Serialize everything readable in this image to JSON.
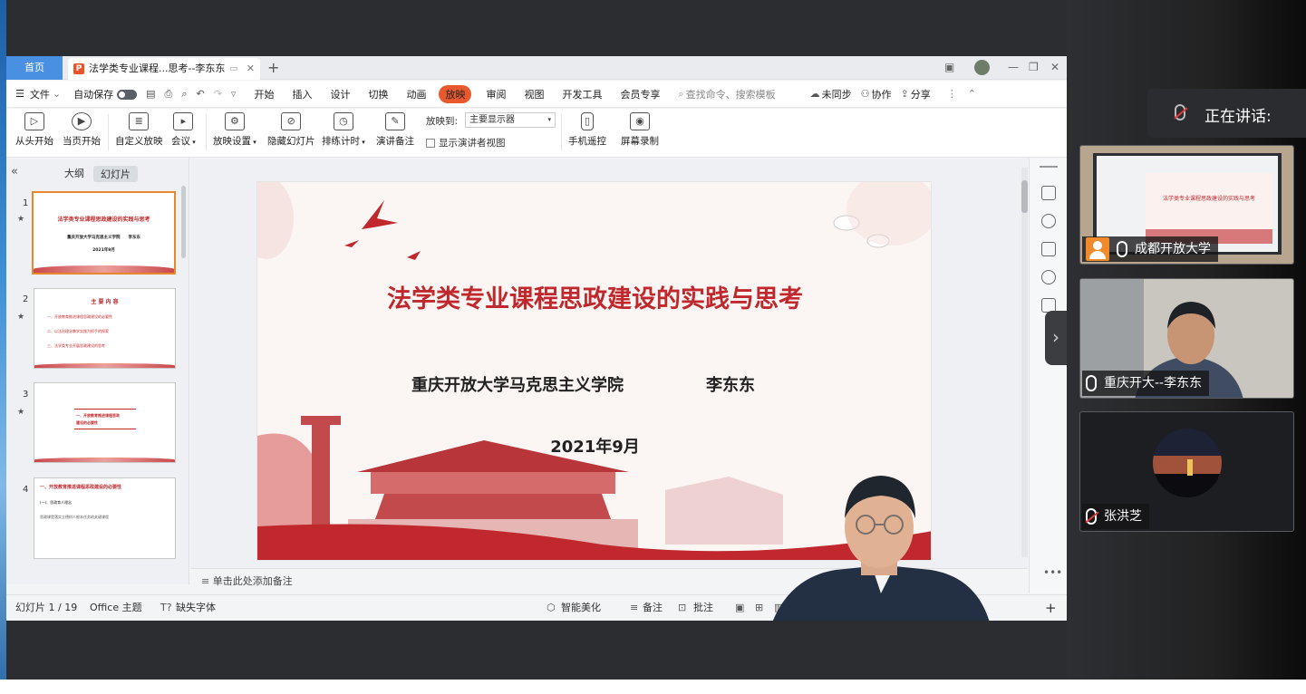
{
  "wps": {
    "home_tab": "首页",
    "doc_tab": "法学类专业课程...思考--李东东",
    "menu": {
      "file": "文件",
      "autosave": "自动保存",
      "items": [
        "开始",
        "插入",
        "设计",
        "切换",
        "动画",
        "放映",
        "审阅",
        "视图",
        "开发工具",
        "会员专享"
      ],
      "active_item": "放映",
      "search": "查找命令、搜索模板",
      "unsync": "未同步",
      "collab": "协作",
      "share": "分享"
    },
    "ribbon": {
      "from_start": "从头开始",
      "from_current": "当页开始",
      "custom_show": "自定义放映",
      "meeting": "会议",
      "show_settings": "放映设置",
      "hide_slide": "隐藏幻灯片",
      "rehearse": "排练计时",
      "speaker_notes": "演讲备注",
      "show_to_label": "放映到:",
      "show_to_value": "主要显示器",
      "presenter_view": "显示演讲者视图",
      "phone_remote": "手机遥控",
      "screen_record": "屏幕录制"
    },
    "left_panel": {
      "tab_outline": "大纲",
      "tab_slides": "幻灯片",
      "thumbs": [
        {
          "num": "1",
          "title": "法学类专业课程思政建设的实践与思考",
          "lines": [
            "重庆开放大学马克思主义学院　　李东东",
            "2021年9月"
          ]
        },
        {
          "num": "2",
          "title": "主 要 内 容",
          "lines": [
            "一、开放教育推进课程思政建设的必要性",
            "二、以法治理念教学实践为抓手的探索",
            "三、法学类专业开展思政建设的思考"
          ]
        },
        {
          "num": "3",
          "title": "",
          "lines": [
            "一、开放教育推进课程思政",
            "建设的必要性"
          ]
        },
        {
          "num": "4",
          "title": "一、开放教育推进课程思政建设的必要性",
          "lines": [
            "(一)、思政育人理念",
            "思政课是落实立德树人根本任务的关键课程"
          ]
        }
      ]
    },
    "slide": {
      "title": "法学类专业课程思政建设的实践与思考",
      "subtitle": "重庆开放大学马克思主义学院",
      "author": "李东东",
      "date": "2021年9月"
    },
    "notes_placeholder": "单击此处添加备注",
    "status": {
      "slide_counter": "幻灯片 1 / 19",
      "theme": "Office 主题",
      "missing_font": "缺失字体",
      "beautify": "智能美化",
      "notes": "备注",
      "comment": "批注"
    }
  },
  "meeting": {
    "speaking_label": "正在讲话:",
    "participants": [
      {
        "name": "成都开放大学",
        "muted": false
      },
      {
        "name": "重庆开大--李东东",
        "muted": false
      },
      {
        "name": "张洪芝",
        "muted": true
      }
    ]
  },
  "colors": {
    "accent": "#e85a2d",
    "slide_red": "#c0282d",
    "home_tab_blue": "#4a90e2"
  }
}
